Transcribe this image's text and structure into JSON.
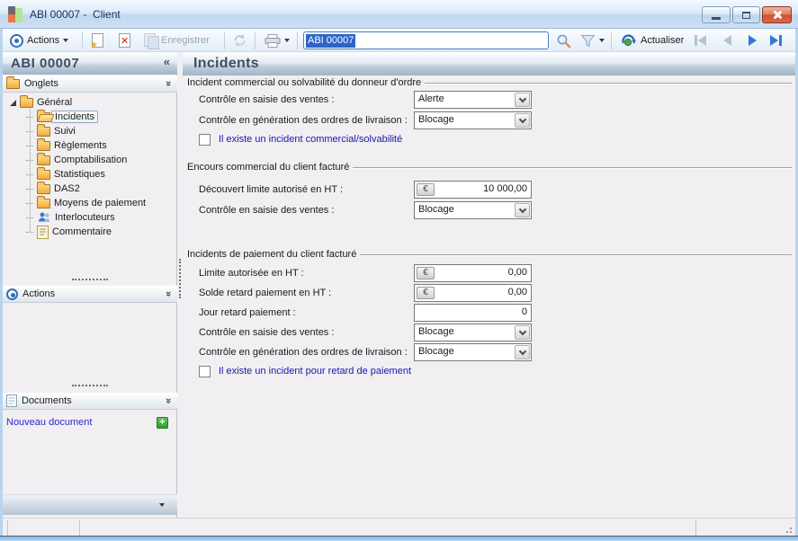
{
  "window": {
    "title": "ABI 00007 -  Client"
  },
  "toolbar": {
    "actions_label": "Actions",
    "save_label": "Enregistrer",
    "search_value": "ABI 00007",
    "refresh_label": "Actualiser"
  },
  "sidebar": {
    "header": "ABI 00007",
    "collapse_glyph": "«",
    "onglets_title": "Onglets",
    "actions_title": "Actions",
    "documents_title": "Documents",
    "new_document_label": "Nouveau document",
    "tree": {
      "root_label": "Général",
      "items": [
        {
          "label": "Incidents"
        },
        {
          "label": "Suivi"
        },
        {
          "label": "Règlements"
        },
        {
          "label": "Comptabilisation"
        },
        {
          "label": "Statistiques"
        },
        {
          "label": "DAS2"
        },
        {
          "label": "Moyens de paiement"
        },
        {
          "label": "Interlocuteurs"
        },
        {
          "label": "Commentaire"
        }
      ]
    }
  },
  "content": {
    "title": "Incidents",
    "section1": {
      "title": "Incident commercial ou solvabilité du donneur d'ordre",
      "row1_label": "Contrôle en saisie des ventes :",
      "row1_value": "Alerte",
      "row2_label": "Contrôle en génération des ordres de livraison :",
      "row2_value": "Blocage",
      "checkbox_label": "Il existe un incident commercial/solvabilité",
      "checkbox_checked": false
    },
    "section2": {
      "title": "Encours commercial du client facturé",
      "row1_label": "Découvert limite autorisé en HT :",
      "row1_currency": "€",
      "row1_value": "10 000,00",
      "row2_label": "Contrôle en saisie des ventes :",
      "row2_value": "Blocage"
    },
    "section3": {
      "title": "Incidents de paiement du client facturé",
      "row1_label": "Limite autorisée en HT :",
      "row1_currency": "€",
      "row1_value": "0,00",
      "row2_label": "Solde retard paiement en HT :",
      "row2_currency": "€",
      "row2_value": "0,00",
      "row3_label": "Jour retard paiement  :",
      "row3_value": "0",
      "row4_label": "Contrôle en saisie des ventes :",
      "row4_value": "Blocage",
      "row5_label": "Contrôle en génération des ordres de livraison :",
      "row5_value": "Blocage",
      "checkbox_label": "Il existe un incident pour retard de paiement",
      "checkbox_checked": false
    }
  },
  "colors": {
    "selection_blue": "#2e64c8",
    "checkbox_label_blue": "#1818aa",
    "link_blue": "#2a2ac8",
    "nav_enabled_blue": "#2f7ad4",
    "folder_orange": "#f3ab3d",
    "close_button_red": "#cf4f30"
  }
}
